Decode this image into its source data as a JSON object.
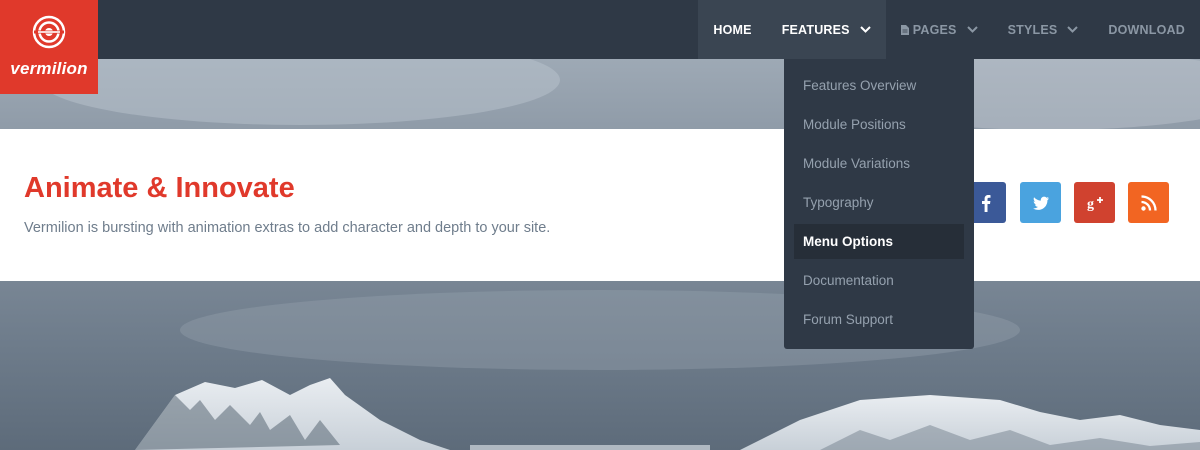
{
  "brand": {
    "name": "vermilion",
    "color": "#e0392b"
  },
  "nav": {
    "items": [
      {
        "label": "HOME"
      },
      {
        "label": "FEATURES"
      },
      {
        "label": "PAGES"
      },
      {
        "label": "STYLES"
      },
      {
        "label": "DOWNLOAD"
      }
    ]
  },
  "dropdown": {
    "items": [
      {
        "label": "Features Overview"
      },
      {
        "label": "Module Positions"
      },
      {
        "label": "Module Variations"
      },
      {
        "label": "Typography"
      },
      {
        "label": "Menu Options",
        "active": true
      },
      {
        "label": "Documentation"
      },
      {
        "label": "Forum Support"
      }
    ]
  },
  "banner": {
    "title": "Animate & Innovate",
    "subtitle": "Vermilion is bursting with animation extras to add character and depth to your site."
  },
  "social": {
    "icons": [
      "facebook-icon",
      "twitter-icon",
      "google-plus-icon",
      "rss-icon"
    ],
    "colors": {
      "facebook": "#3b5998",
      "twitter": "#4aa3df",
      "google_plus": "#d0422f",
      "rss": "#f26522"
    }
  }
}
